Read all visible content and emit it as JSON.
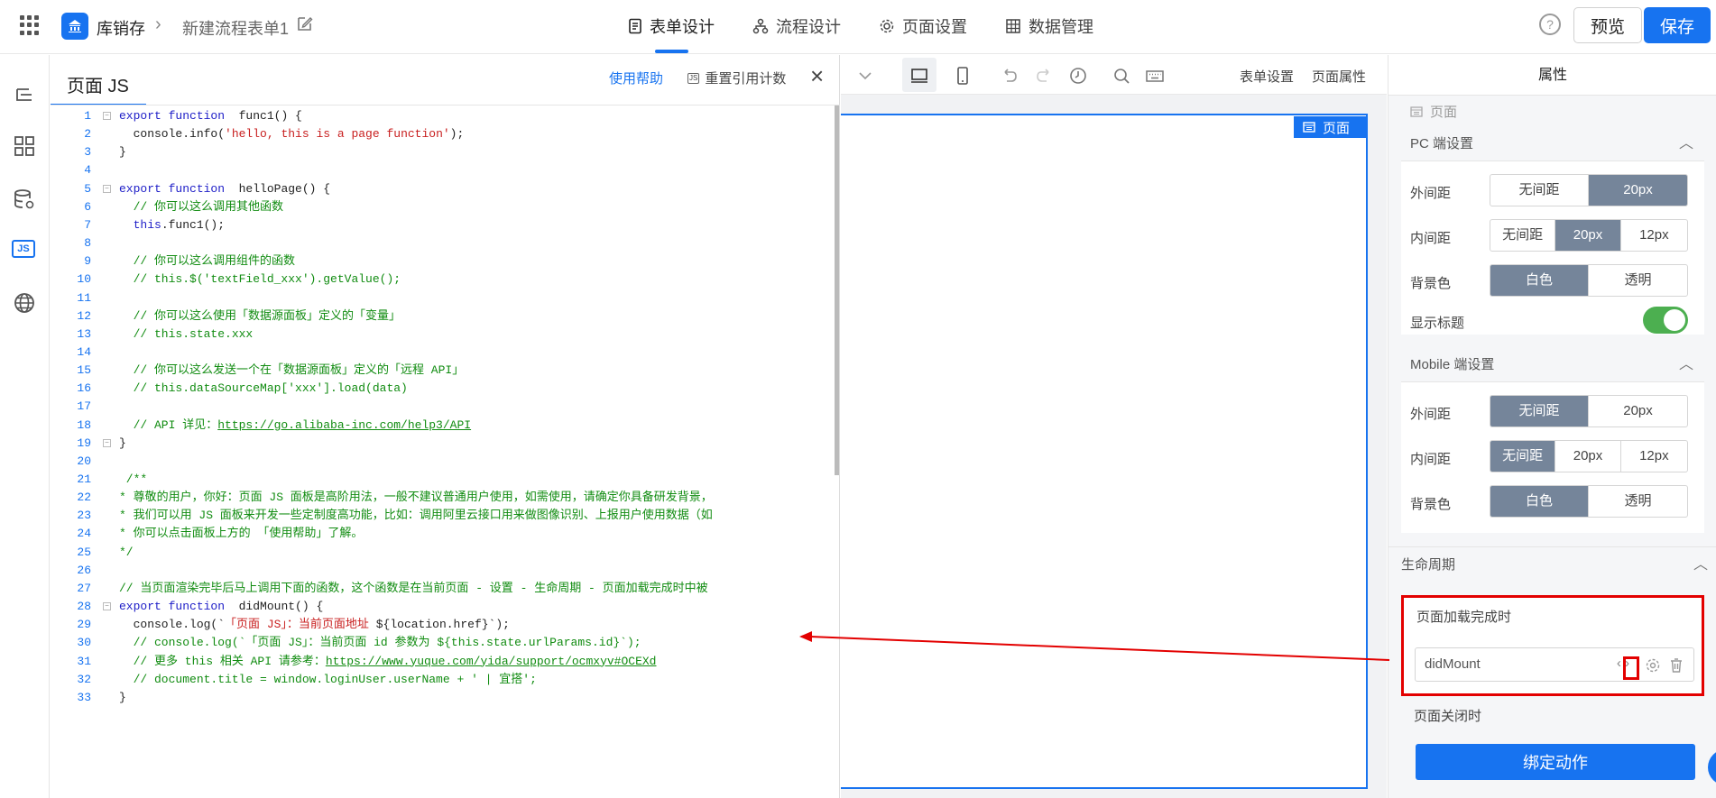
{
  "header": {
    "app_name": "库销存",
    "form_name": "新建流程表单1",
    "tabs": [
      {
        "label": "表单设计",
        "active": true
      },
      {
        "label": "流程设计"
      },
      {
        "label": "页面设置"
      },
      {
        "label": "数据管理"
      }
    ],
    "help": "?",
    "preview_label": "预览",
    "save_label": "保存",
    "accent": "#1773f0"
  },
  "rail": {
    "items": [
      "outline-icon",
      "components-icon",
      "datasource-icon",
      "js-icon",
      "globe-icon"
    ],
    "js_label": "JS"
  },
  "js_panel": {
    "title": "页面 JS",
    "help_link": "使用帮助",
    "reset_label": "重置引用计数",
    "js_badge": "JS",
    "close": "×",
    "code_lines": [
      {
        "n": "1",
        "fold": true,
        "parts": [
          [
            "kw",
            "export function"
          ],
          [
            "",
            "  func1() {"
          ]
        ]
      },
      {
        "n": "2",
        "parts": [
          [
            "",
            "  console.info("
          ],
          [
            "str",
            "'hello, this is a page function'"
          ],
          [
            "",
            ");"
          ]
        ]
      },
      {
        "n": "3",
        "parts": [
          [
            "",
            "}"
          ]
        ]
      },
      {
        "n": "4",
        "parts": []
      },
      {
        "n": "5",
        "fold": true,
        "parts": [
          [
            "kw",
            "export function"
          ],
          [
            "",
            "  helloPage() {"
          ]
        ]
      },
      {
        "n": "6",
        "parts": [
          [
            "cm",
            "  // 你可以这么调用其他函数"
          ]
        ]
      },
      {
        "n": "7",
        "parts": [
          [
            "kw",
            "  this"
          ],
          [
            "",
            ".func1();"
          ]
        ]
      },
      {
        "n": "8",
        "parts": []
      },
      {
        "n": "9",
        "parts": [
          [
            "cm",
            "  // 你可以这么调用组件的函数"
          ]
        ]
      },
      {
        "n": "10",
        "parts": [
          [
            "cm",
            "  // this.$('textField_xxx').getValue();"
          ]
        ]
      },
      {
        "n": "11",
        "parts": []
      },
      {
        "n": "12",
        "parts": [
          [
            "cm",
            "  // 你可以这么使用「数据源面板」定义的「变量」"
          ]
        ]
      },
      {
        "n": "13",
        "parts": [
          [
            "cm",
            "  // this.state.xxx"
          ]
        ]
      },
      {
        "n": "14",
        "parts": []
      },
      {
        "n": "15",
        "parts": [
          [
            "cm",
            "  // 你可以这么发送一个在「数据源面板」定义的「远程 API」"
          ]
        ]
      },
      {
        "n": "16",
        "parts": [
          [
            "cm",
            "  // this.dataSourceMap['xxx'].load(data)"
          ]
        ]
      },
      {
        "n": "17",
        "parts": []
      },
      {
        "n": "18",
        "parts": [
          [
            "cm",
            "  // API 详见："
          ],
          [
            "cm-link",
            "https://go.alibaba-inc.com/help3/API"
          ]
        ]
      },
      {
        "n": "19",
        "fold": true,
        "parts": [
          [
            "",
            "}"
          ]
        ]
      },
      {
        "n": "20",
        "parts": []
      },
      {
        "n": "21",
        "parts": [
          [
            "cm",
            " /**"
          ]
        ]
      },
      {
        "n": "22",
        "parts": [
          [
            "cm",
            "* 尊敬的用户，你好：页面 JS 面板是高阶用法，一般不建议普通用户使用，如需使用，请确定你具备研发背景，"
          ]
        ]
      },
      {
        "n": "23",
        "parts": [
          [
            "cm",
            "* 我们可以用 JS 面板来开发一些定制度高功能，比如：调用阿里云接口用来做图像识别、上报用户使用数据（如"
          ]
        ]
      },
      {
        "n": "24",
        "parts": [
          [
            "cm",
            "* 你可以点击面板上方的 「使用帮助」了解。"
          ]
        ]
      },
      {
        "n": "25",
        "parts": [
          [
            "cm",
            "*/"
          ]
        ]
      },
      {
        "n": "26",
        "parts": []
      },
      {
        "n": "27",
        "parts": [
          [
            "cm",
            "// 当页面渲染完毕后马上调用下面的函数，这个函数是在当前页面 - 设置 - 生命周期 - 页面加载完成时中被"
          ]
        ]
      },
      {
        "n": "28",
        "fold": true,
        "parts": [
          [
            "kw",
            "export function"
          ],
          [
            "",
            "  didMount() {"
          ]
        ]
      },
      {
        "n": "29",
        "parts": [
          [
            "",
            "  console.log(`"
          ],
          [
            "str",
            "「页面 JS」：当前页面地址"
          ],
          [
            "",
            " ${location.href}`);"
          ]
        ]
      },
      {
        "n": "30",
        "parts": [
          [
            "cm",
            "  // console.log(`「页面 JS」：当前页面 id 参数为 ${this.state.urlParams.id}`);"
          ]
        ]
      },
      {
        "n": "31",
        "parts": [
          [
            "cm",
            "  // 更多 this 相关 API 请参考："
          ],
          [
            "cm-link",
            "https://www.yuque.com/yida/support/ocmxyv#OCEXd"
          ]
        ]
      },
      {
        "n": "32",
        "parts": [
          [
            "cm",
            "  // document.title = window.loginUser.userName + ' | 宜搭';"
          ]
        ]
      },
      {
        "n": "33",
        "parts": [
          [
            "",
            "}"
          ]
        ]
      }
    ]
  },
  "canvas": {
    "toolbar_text_1": "表单设置",
    "toolbar_text_2": "页面属性",
    "page_tag": "页面"
  },
  "props": {
    "title": "属性",
    "sub": "页面",
    "pc_title": "PC 端设置",
    "mobile_title": "Mobile 端设置",
    "outer": "外间距",
    "inner": "内间距",
    "bg": "背景色",
    "show_title": "显示标题",
    "opt_none": "无间距",
    "opt_20": "20px",
    "opt_12": "12px",
    "opt_white": "白色",
    "opt_transparent": "透明",
    "lifecycle": "生命周期",
    "on_load": "页面加载完成时",
    "on_load_value": "didMount",
    "on_close": "页面关闭时",
    "bind_action": "绑定动作",
    "code_icon": "‹›"
  }
}
